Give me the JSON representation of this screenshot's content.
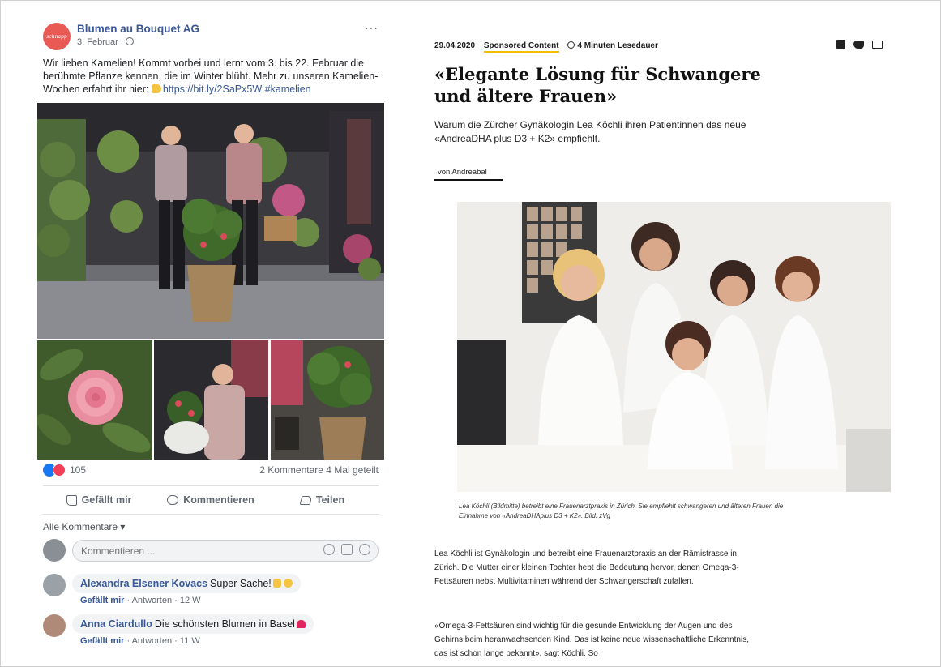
{
  "facebook_post": {
    "page_name": "Blumen au Bouquet AG",
    "avatar_text": "schnapp",
    "date": "3. Februar ·",
    "more_label": "···",
    "text": "Wir lieben Kamelien! Kommt vorbei und lernt vom 3. bis 22. Februar die berühmte Pflanze kennen, die im Winter blüht. Mehr zu unseren Kamelien-Wochen erfahrt ihr hier: ",
    "link": "https://bit.ly/2SaPx5W",
    "hashtag": "#kamelien",
    "reactions_count": "105",
    "comments_shares": "2 Kommentare  4 Mal geteilt",
    "actions": {
      "like": "Gefällt mir",
      "comment": "Kommentieren",
      "share": "Teilen"
    },
    "all_comments_label": "Alle Kommentare ▾",
    "comment_placeholder": "Kommentieren ...",
    "comments": [
      {
        "name": "Alexandra Elsener Kovacs",
        "text": "Super Sache!",
        "meta_like": "Gefällt mir",
        "meta_rest": " · Antworten · 12 W"
      },
      {
        "name": "Anna Ciardullo",
        "text": "Die schönsten Blumen in Basel",
        "meta_like": "Gefällt mir",
        "meta_rest": " · Antworten · 11 W"
      }
    ]
  },
  "article": {
    "date": "29.04.2020",
    "sponsored": "Sponsored Content",
    "reading_time": "4 Minuten Lesedauer",
    "title": "«Elegante Lösung für Schwangere und ältere Frauen»",
    "lead": "Warum die Zürcher Gynäkologin Lea Köchli ihren Patientinnen das neue «AndreaDHA plus D3 + K2» empfiehlt.",
    "author": "von Andreabal",
    "caption": "Lea Köchli (Bildmitte) betreibt eine Frauenarztpraxis in Zürich. Sie empfiehlt schwangeren und älteren Frauen die Einnahme von «AndreaDHAplus D3 + K2». Bild: zVg",
    "paragraph_1": "Lea Köchli ist Gynäkologin und betreibt eine Frauenarztpraxis an der Rämistrasse in Zürich. Die Mutter einer kleinen Tochter hebt die Bedeutung hervor, denen Omega-3-Fettsäuren nebst Multivitaminen während der Schwangerschaft zufallen.",
    "paragraph_2": "«Omega-3-Fettsäuren sind wichtig für die gesunde Entwicklung der Augen und des Gehirns beim heranwachsenden Kind. Das ist keine neue wissenschaftliche Erkenntnis, das ist schon lange bekannt», sagt Köchli. So"
  },
  "icons": {
    "share": [
      "facebook-icon",
      "twitter-icon",
      "mail-icon"
    ],
    "reactions": [
      "like-reaction-icon",
      "love-reaction-icon"
    ]
  },
  "colors": {
    "fb_link": "#385898",
    "fb_blue": "#1877f2",
    "fb_love": "#f33e58",
    "sponsored_underline": "#f0c000"
  }
}
